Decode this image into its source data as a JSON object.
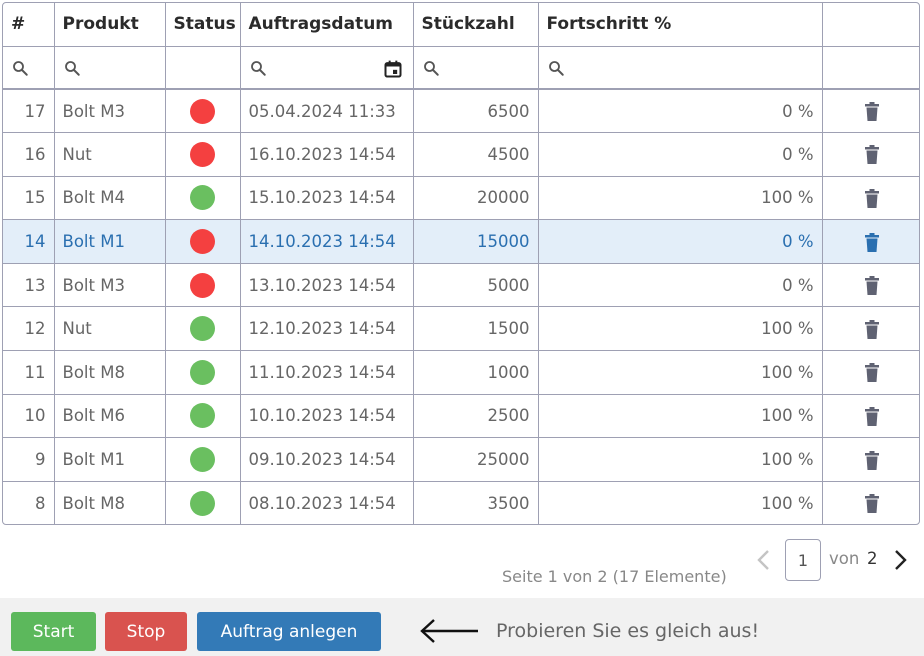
{
  "columns": [
    "#",
    "Produkt",
    "Status",
    "Auftragsdatum",
    "Stückzahl",
    "Fortschritt %",
    ""
  ],
  "status_colors": {
    "red": "#f44040",
    "green": "#6abf60"
  },
  "icons": {
    "filter": "search-icon",
    "date": "calendar-icon",
    "delete": "trash-icon"
  },
  "rows": [
    {
      "id": "17",
      "product": "Bolt M3",
      "status": "red",
      "date": "05.04.2024 11:33",
      "qty": "6500",
      "progress": "0 %"
    },
    {
      "id": "16",
      "product": "Nut",
      "status": "red",
      "date": "16.10.2023 14:54",
      "qty": "4500",
      "progress": "0 %"
    },
    {
      "id": "15",
      "product": "Bolt M4",
      "status": "green",
      "date": "15.10.2023 14:54",
      "qty": "20000",
      "progress": "100 %"
    },
    {
      "id": "14",
      "product": "Bolt M1",
      "status": "red",
      "date": "14.10.2023 14:54",
      "qty": "15000",
      "progress": "0 %"
    },
    {
      "id": "13",
      "product": "Bolt M3",
      "status": "red",
      "date": "13.10.2023 14:54",
      "qty": "5000",
      "progress": "0 %"
    },
    {
      "id": "12",
      "product": "Nut",
      "status": "green",
      "date": "12.10.2023 14:54",
      "qty": "1500",
      "progress": "100 %"
    },
    {
      "id": "11",
      "product": "Bolt M8",
      "status": "green",
      "date": "11.10.2023 14:54",
      "qty": "1000",
      "progress": "100 %"
    },
    {
      "id": "10",
      "product": "Bolt M6",
      "status": "green",
      "date": "10.10.2023 14:54",
      "qty": "2500",
      "progress": "100 %"
    },
    {
      "id": "9",
      "product": "Bolt M1",
      "status": "green",
      "date": "09.10.2023 14:54",
      "qty": "25000",
      "progress": "100 %"
    },
    {
      "id": "8",
      "product": "Bolt M8",
      "status": "green",
      "date": "08.10.2023 14:54",
      "qty": "3500",
      "progress": "100 %"
    }
  ],
  "selected_row_id": "14",
  "pager": {
    "summary": "Seite 1 von 2 (17 Elemente)",
    "current": "1",
    "of_label": "von",
    "total": "2"
  },
  "buttons": {
    "start": "Start",
    "stop": "Stop",
    "new_order": "Auftrag anlegen"
  },
  "hint": "Probieren Sie es gleich aus!"
}
